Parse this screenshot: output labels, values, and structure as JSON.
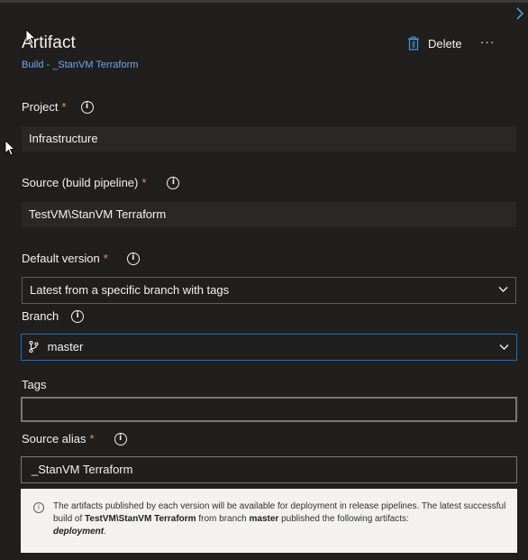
{
  "panel": {
    "title": "Artifact",
    "subtitle": "Build - _StanVM Terraform",
    "close_icon": "chevron-right-icon",
    "actions": {
      "delete_label": "Delete",
      "delete_icon": "trash-icon",
      "more_label": "···"
    }
  },
  "fields": {
    "project": {
      "label": "Project",
      "required": "*",
      "value": "Infrastructure"
    },
    "source": {
      "label": "Source (build pipeline)",
      "required": "*",
      "value": "TestVM\\StanVM Terraform"
    },
    "default_version": {
      "label": "Default version",
      "required": "*",
      "value": "Latest from a specific branch with tags"
    },
    "branch": {
      "label": "Branch",
      "value": "master",
      "icon": "git-branch-icon"
    },
    "tags": {
      "label": "Tags",
      "value": ""
    },
    "source_alias": {
      "label": "Source alias",
      "required": "*",
      "value": "_StanVM Terraform"
    }
  },
  "info_message": {
    "part1": "The artifacts published by each version will be available for deployment in release pipelines. The latest successful build of ",
    "pipeline": "TestVM\\StanVM Terraform",
    "part2": " from branch ",
    "branch": "master",
    "part3": " published the following artifacts: ",
    "artifact": "deployment",
    "part4": "."
  },
  "info_glyph": "i",
  "colors": {
    "background": "#201f1e",
    "link": "#6ea9ef",
    "focus_border": "#1a6ec2",
    "required": "#e8867a",
    "message_bg": "#f3f2f1"
  }
}
